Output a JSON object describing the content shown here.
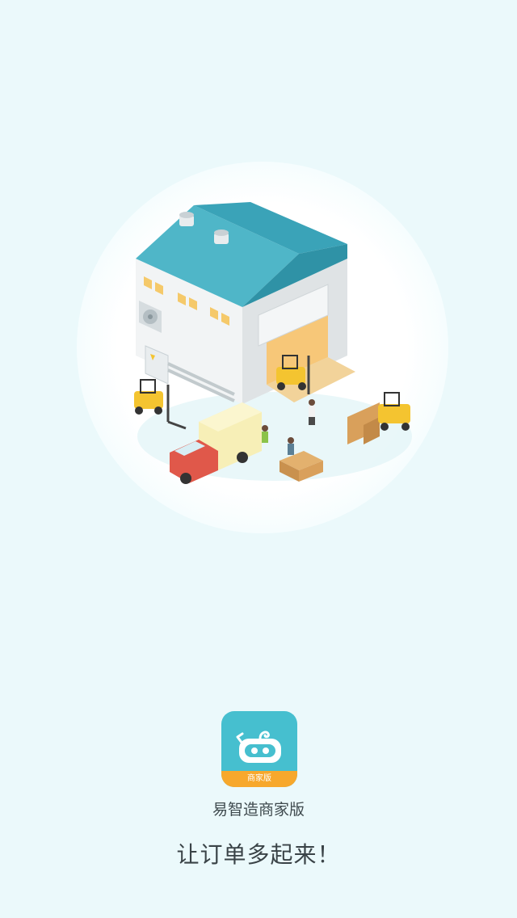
{
  "splash": {
    "app_name": "易智造商家版",
    "slogan": "让订单多起来！",
    "icon_badge": "商家版"
  },
  "colors": {
    "background": "#ebf9fb",
    "icon_teal": "#46bfcf",
    "icon_orange": "#f7a82c",
    "roof_blue": "#3aa9bd",
    "truck_red": "#e0584a",
    "forklift_yellow": "#f4c430"
  },
  "icons": {
    "illustration": "warehouse-illustration",
    "app_logo": "robot-face-icon"
  }
}
